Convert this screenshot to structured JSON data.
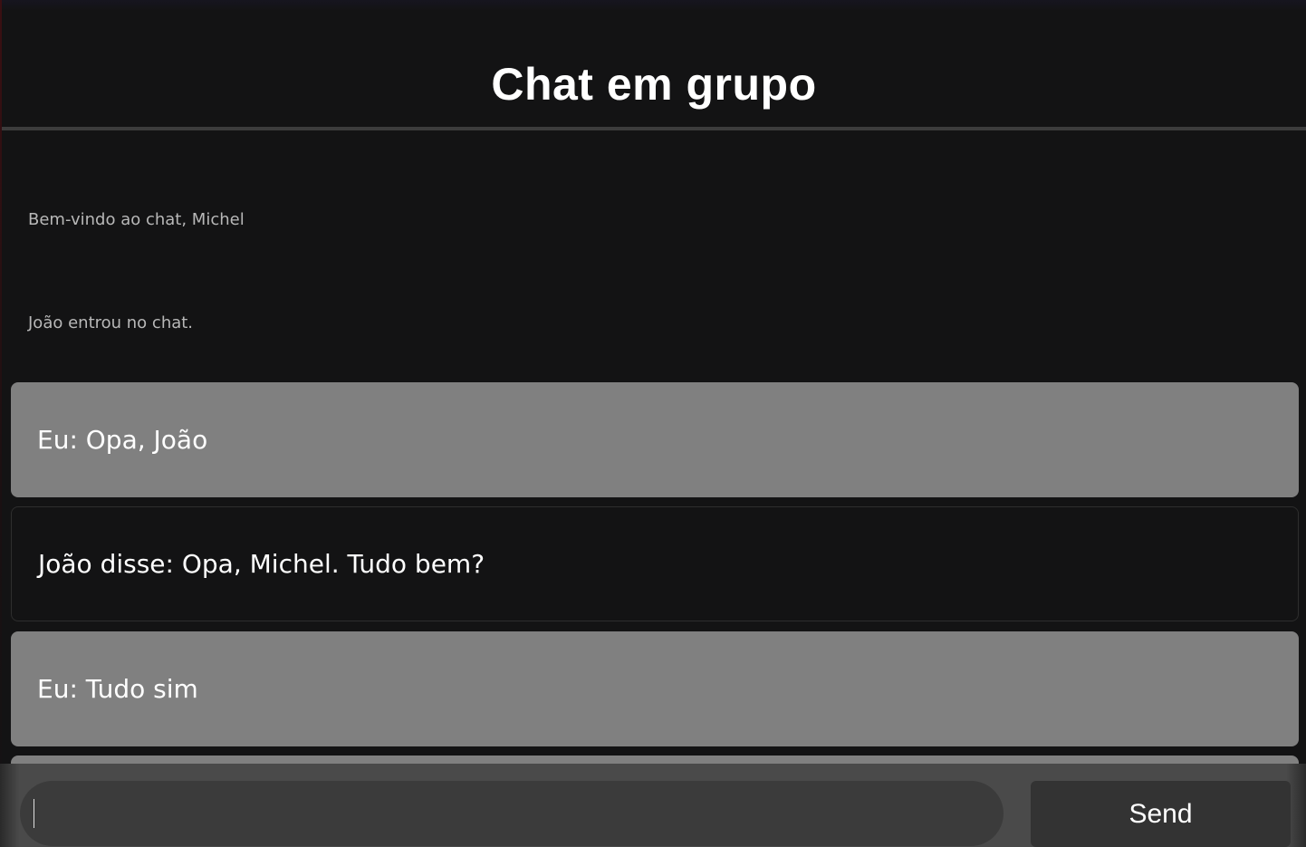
{
  "header": {
    "title": "Chat em grupo"
  },
  "messages": {
    "system": [
      {
        "text": "Bem-vindo ao chat, Michel"
      },
      {
        "text": "João entrou no chat."
      }
    ],
    "bubbles": [
      {
        "sender": "mine",
        "text": "Eu: Opa, João"
      },
      {
        "sender": "theirs",
        "text": "João disse: Opa, Michel. Tudo bem?"
      },
      {
        "sender": "mine",
        "text": "Eu: Tudo sim"
      }
    ]
  },
  "composer": {
    "input_value": "",
    "send_label": "Send"
  },
  "colors": {
    "background": "#131314",
    "my_bubble": "#808080",
    "send_button": "#333333",
    "input": "#3b3b3b"
  }
}
